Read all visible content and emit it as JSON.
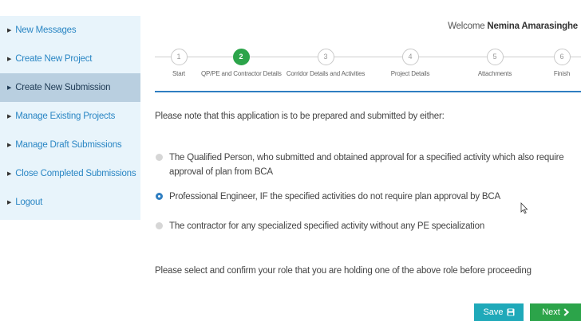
{
  "sidebar": {
    "items": [
      {
        "label": "New Messages",
        "active": false
      },
      {
        "label": "Create New Project",
        "active": false
      },
      {
        "label": "Create New Submission",
        "active": true
      },
      {
        "label": "Manage Existing Projects",
        "active": false
      },
      {
        "label": "Manage Draft Submissions",
        "active": false
      },
      {
        "label": "Close Completed Submissions",
        "active": false
      },
      {
        "label": "Logout",
        "active": false
      }
    ]
  },
  "header": {
    "welcome_prefix": "Welcome",
    "user_name": "Nemina Amarasinghe"
  },
  "stepper": {
    "current_step": 2,
    "steps": [
      {
        "number": "1",
        "label": "Start"
      },
      {
        "number": "2",
        "label": "QP/PE and Contractor Details"
      },
      {
        "number": "3",
        "label": "Corridor Details and Activities"
      },
      {
        "number": "4",
        "label": "Project Details"
      },
      {
        "number": "5",
        "label": "Attachments"
      },
      {
        "number": "6",
        "label": "Finish"
      }
    ]
  },
  "form": {
    "note": "Please note that this application is to be prepared and submitted by either:",
    "options": [
      {
        "label": "The Qualified Person, who submitted and obtained approval for a specified activity which also require approval of plan from BCA",
        "selected": false
      },
      {
        "label": "Professional Engineer, IF the specified activities do not require plan approval by BCA",
        "selected": true
      },
      {
        "label": "The contractor for any specialized specified activity without any PE specialization",
        "selected": false
      }
    ],
    "confirm_text": "Please select and confirm your role that you are holding one of the above role before proceeding"
  },
  "actions": {
    "save_label": "Save",
    "next_label": "Next"
  },
  "icons": {
    "nav_arrow": "triangle-right-icon",
    "save": "floppy-disk-icon",
    "next": "chevron-right-icon"
  },
  "colors": {
    "primary": "#2f7ec1",
    "success": "#2ca44a",
    "save_button": "#1fa9b9",
    "sidebar_bg": "#e8f4fb",
    "sidebar_active": "#b9cfe0"
  }
}
